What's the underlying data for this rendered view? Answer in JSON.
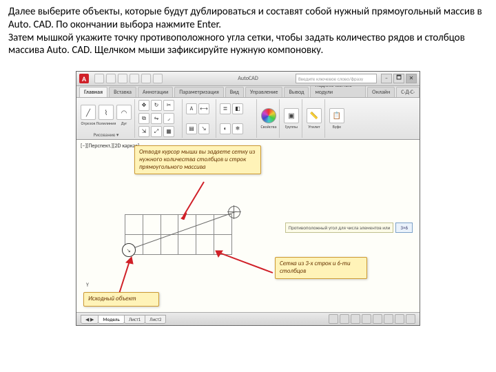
{
  "instructions": {
    "line1": "Далее выберите объекты, которые будут дублироваться и составят собой нужный прямоугольный массив в Auto. CAD. По окончании выбора нажмите Enter.",
    "line2": "Затем мышкой укажите точку противоположного угла сетки, чтобы задать количество рядов и столбцов массива Auto. CAD. Щелчком мыши зафиксируйте нужную компоновку."
  },
  "app": {
    "logo": "A",
    "title_text": "AutoCAD",
    "search_placeholder": "Введите ключевое слово/фразу",
    "help_btn": "?",
    "min_btn": "–",
    "max_btn": "🗖",
    "close_btn": "✕"
  },
  "tabs": {
    "items": [
      "Главная",
      "Вставка",
      "Аннотации",
      "Параметризация",
      "Вид",
      "Управление",
      "Вывод",
      "Подключаемые модули",
      "Онлайн"
    ],
    "right": "С·Д·С·"
  },
  "ribbon": {
    "draw": {
      "line": "Отрезок",
      "polyline": "Полилиния",
      "arc": "Дуг"
    },
    "draw_group_label": "Рисование ▾",
    "props": "Свойства",
    "groups": "Группы",
    "utils": "Утилит",
    "clipboard": "Буфе"
  },
  "viewport": {
    "label": "[–][Перспект.][2D каркас]",
    "axis_y": "Y"
  },
  "callouts": {
    "c1": "Отводя курсор мыши вы задаете сетку из нужного количества столбцов и строк прямоугольного массива",
    "c2": "Сетка из 3-х строк и 6-ти столбцов",
    "c3": "Исходный объект"
  },
  "origin_marker": "↘",
  "cmd": {
    "text": "Противоположный угол для числа элементов или",
    "input": "3×6"
  },
  "paper_tabs": {
    "items": [
      "Модель",
      "Лист1",
      "Лист2"
    ],
    "nav": "◀ ▶"
  }
}
